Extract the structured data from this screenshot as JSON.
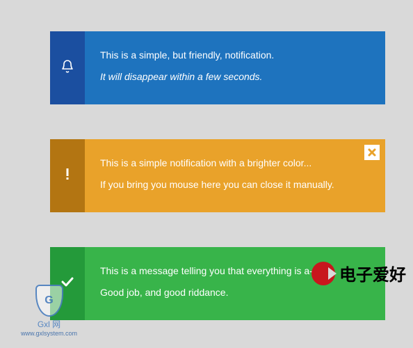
{
  "notifications": [
    {
      "variant": "blue",
      "icon": "bell-icon",
      "line1": "This is a simple, but friendly, notification.",
      "line2": "It will disappear within a few seconds.",
      "line2_italic": true,
      "dismissible": false
    },
    {
      "variant": "orange",
      "icon": "exclamation-icon",
      "line1": "This is a simple notification with a brighter color...",
      "line2": "If you bring you mouse here you can close it manually.",
      "line2_italic": false,
      "dismissible": true
    },
    {
      "variant": "green",
      "icon": "check-icon",
      "line1": "This is a message telling you that everything is a-okay.",
      "line2": "Good job, and good riddance.",
      "line2_italic": false,
      "dismissible": false
    }
  ],
  "colors": {
    "blue_dark": "#1b4fa0",
    "blue": "#1e73be",
    "orange_dark": "#b37512",
    "orange": "#e9a22a",
    "green_dark": "#249a3a",
    "green": "#38b44a",
    "page_bg": "#d9d9d9"
  },
  "watermarks": {
    "left_logo_text": "Gxl 网",
    "left_logo_sub": "www.gxlsystem.com",
    "right_logo_text": "电子爱好"
  }
}
